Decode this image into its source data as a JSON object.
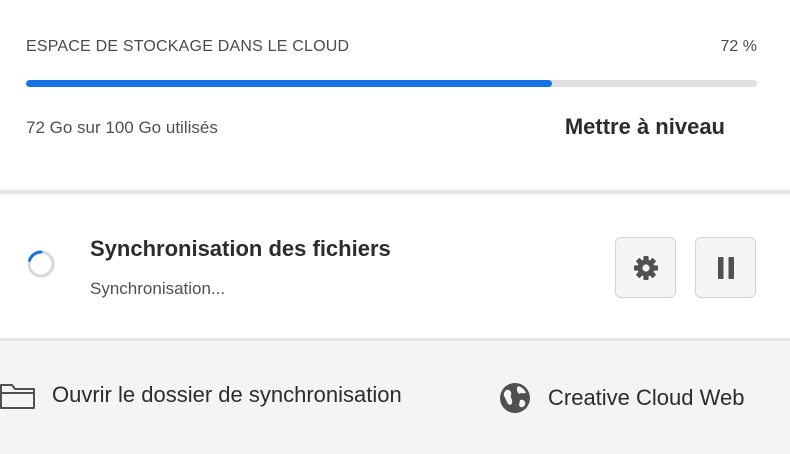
{
  "storage": {
    "title": "ESPACE DE STOCKAGE DANS LE CLOUD",
    "percent_label": "72 %",
    "used_fraction": 0.72,
    "used_label": "72 Go sur 100 Go utilisés",
    "upgrade_label": "Mettre à niveau"
  },
  "sync": {
    "title": "Synchronisation des fichiers",
    "status": "Synchronisation...",
    "settings_icon": "gear-icon",
    "pause_icon": "pause-icon"
  },
  "footer": {
    "open_folder_label": "Ouvrir le dossier de synchronisation",
    "open_folder_icon": "folder-icon",
    "web_label": "Creative Cloud Web",
    "web_icon": "globe-icon"
  },
  "colors": {
    "accent": "#1473e6"
  }
}
